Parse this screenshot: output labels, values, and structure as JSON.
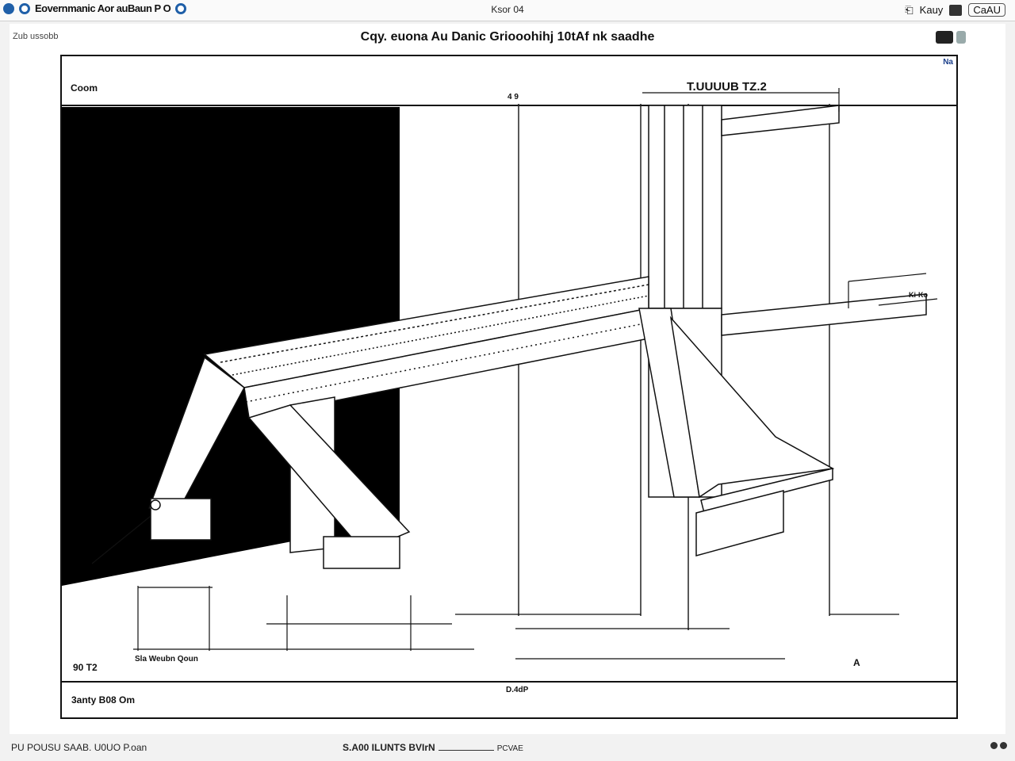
{
  "topbar": {
    "app_title": "Eovernmanic Aor auBaun P O",
    "center_label": "Ksor 04",
    "right_label": "Kauy",
    "right_button": "CaAU"
  },
  "page": {
    "breadcrumb": "Zub ussobb",
    "title": "Cqy. euona Au Danic  Griooohihj 10tAf nk saadhe",
    "nav_link": "Na"
  },
  "drawing": {
    "label_top_left": "Coom",
    "label_dim_top": "T.UUUUB TZ.2",
    "label_mark_a": "4 9",
    "label_mark_right": "Ki-Ko",
    "label_bottom_left": "90 T2",
    "label_bottom_mid": "Sla Weubn  Qoun",
    "label_bottom_right": "A",
    "caption_left": "3anty B08 Om",
    "caption_center": "D.4dP"
  },
  "statusbar": {
    "left": "PU POUSU SAAB. U0UO   P.oan",
    "center": "S.A00 ILUNTS BVIrN",
    "center_suffix": "PCVAE"
  }
}
